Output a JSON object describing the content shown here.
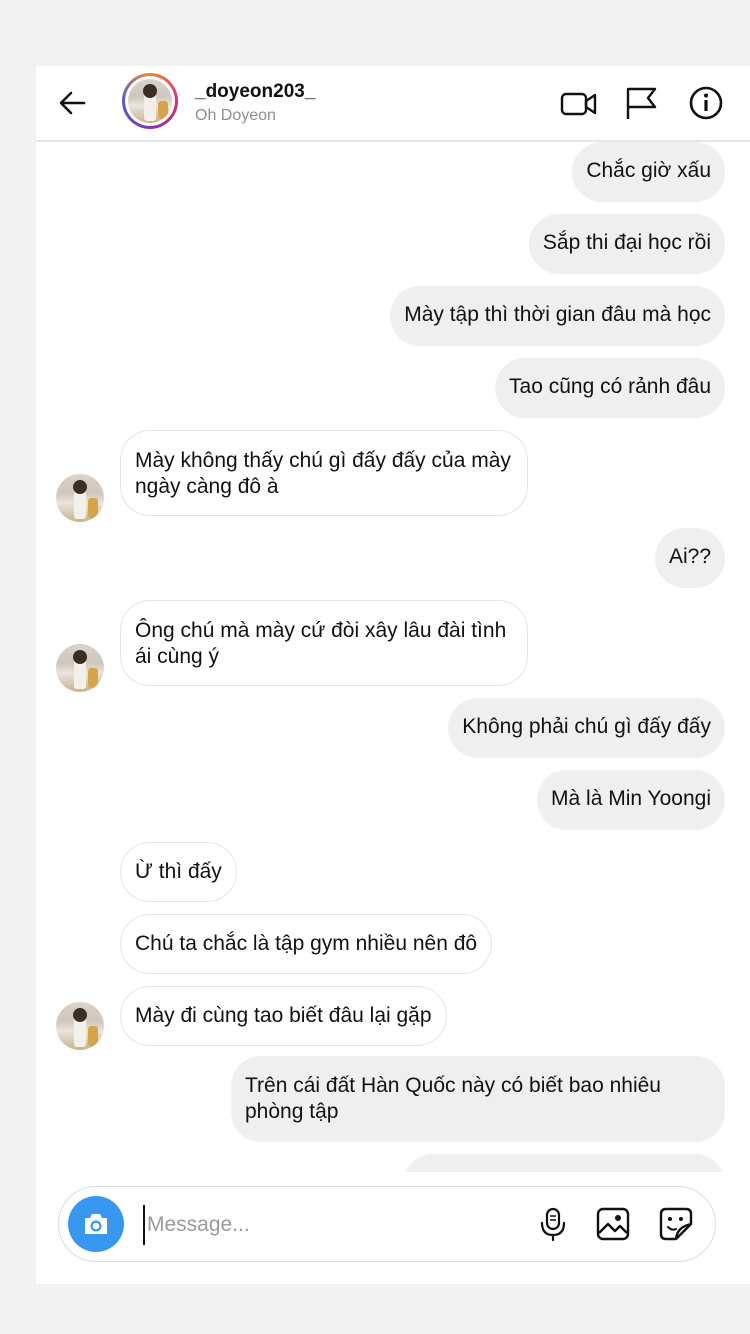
{
  "header": {
    "username": "_doyeon203_",
    "real_name": "Oh Doyeon",
    "icons": [
      "back-arrow-icon",
      "video-call-icon",
      "flag-icon",
      "info-icon"
    ]
  },
  "messages": [
    {
      "side": "out",
      "text": "Chắc giờ xấu"
    },
    {
      "side": "out",
      "text": "Sắp thi đại học rồi"
    },
    {
      "side": "out",
      "text": "Mày tập thì thời gian đâu mà học"
    },
    {
      "side": "out",
      "text": "Tao cũng có rảnh đâu"
    },
    {
      "side": "in",
      "text": "Mày không thấy chú gì đấy đấy của mày ngày càng đô à"
    },
    {
      "side": "out",
      "text": "Ai??"
    },
    {
      "side": "in",
      "text": "Ông chú mà mày cứ đòi xây lâu đài tình ái cùng ý"
    },
    {
      "side": "out",
      "text": "Không phải chú gì đấy đấy"
    },
    {
      "side": "out",
      "text": "Mà là Min Yoongi"
    },
    {
      "side": "in",
      "text": "Ừ thì đấy"
    },
    {
      "side": "in",
      "text": "Chú ta chắc là tập gym nhiều nên đô"
    },
    {
      "side": "in",
      "text": "Mày đi cùng tao biết đâu lại gặp"
    },
    {
      "side": "out",
      "text": "Trên cái đất Hàn Quốc này có biết bao nhiêu phòng tập"
    },
    {
      "side": "out",
      "text": ""
    }
  ],
  "composer": {
    "placeholder": "Message...",
    "icons": [
      "camera-icon",
      "microphone-icon",
      "gallery-icon",
      "sticker-icon"
    ]
  },
  "colors": {
    "camera_button": "#3897f0",
    "outgoing_bubble": "#efefef",
    "incoming_border": "#e4e4e4"
  }
}
